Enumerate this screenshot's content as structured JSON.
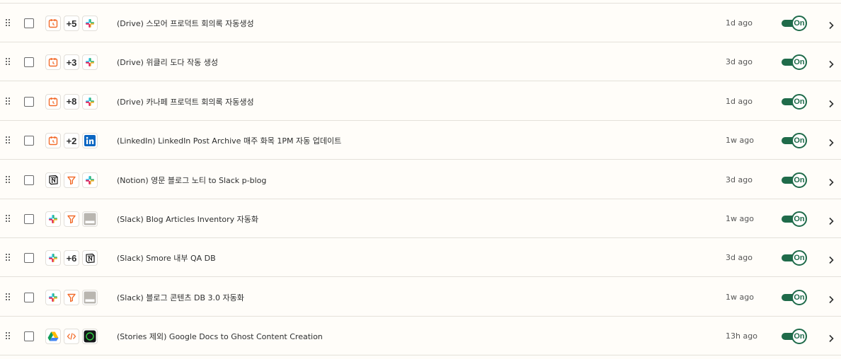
{
  "colors": {
    "toggle_on": "#1f6b4a",
    "schedule": "#f26b2a",
    "filter": "#f26b2a",
    "linkedin": "#0a66c2",
    "slack_blue": "#36c5f0",
    "slack_green": "#2eb67d",
    "slack_yellow": "#ecb22e",
    "slack_red": "#e01e5a"
  },
  "rows": [
    {
      "title": "(Drive) 스모어 프로덕트 회의록 자동생성",
      "time": "1d ago",
      "toggle": "On",
      "apps": [
        {
          "icon": "schedule-icon"
        },
        {
          "icon": "plus-count",
          "text": "+5"
        },
        {
          "icon": "slack-icon"
        }
      ]
    },
    {
      "title": "(Drive) 위클리 도다 작동 생성",
      "time": "3d ago",
      "toggle": "On",
      "apps": [
        {
          "icon": "schedule-icon"
        },
        {
          "icon": "plus-count",
          "text": "+3"
        },
        {
          "icon": "slack-icon"
        }
      ]
    },
    {
      "title": "(Drive) 카나페 프로덕트 회의록 자동생성",
      "time": "1d ago",
      "toggle": "On",
      "apps": [
        {
          "icon": "schedule-icon"
        },
        {
          "icon": "plus-count",
          "text": "+8"
        },
        {
          "icon": "slack-icon"
        }
      ]
    },
    {
      "title": "(LinkedIn) LinkedIn Post Archive 매주 화목 1PM 자동 업데이트",
      "time": "1w ago",
      "toggle": "On",
      "apps": [
        {
          "icon": "schedule-icon"
        },
        {
          "icon": "plus-count",
          "text": "+2"
        },
        {
          "icon": "linkedin-icon"
        }
      ]
    },
    {
      "title": "(Notion) 영문 블로그 노티 to Slack p-blog",
      "time": "3d ago",
      "toggle": "On",
      "apps": [
        {
          "icon": "notion-icon"
        },
        {
          "icon": "filter-icon"
        },
        {
          "icon": "slack-icon"
        }
      ]
    },
    {
      "title": "(Slack) Blog Articles Inventory 자동화",
      "time": "1w ago",
      "toggle": "On",
      "apps": [
        {
          "icon": "slack-icon"
        },
        {
          "icon": "filter-icon"
        },
        {
          "icon": "table-icon"
        }
      ]
    },
    {
      "title": "(Slack) Smore 내부 QA DB",
      "time": "3d ago",
      "toggle": "On",
      "apps": [
        {
          "icon": "slack-icon"
        },
        {
          "icon": "plus-count",
          "text": "+6"
        },
        {
          "icon": "notion-icon"
        }
      ]
    },
    {
      "title": "(Slack) 블로그 콘텐츠 DB 3.0 자동화",
      "time": "1w ago",
      "toggle": "On",
      "apps": [
        {
          "icon": "slack-icon"
        },
        {
          "icon": "filter-icon"
        },
        {
          "icon": "table-icon"
        }
      ]
    },
    {
      "title": "(Stories 제외) Google Docs to Ghost Content Creation",
      "time": "13h ago",
      "toggle": "On",
      "apps": [
        {
          "icon": "google-drive-icon"
        },
        {
          "icon": "code-icon"
        },
        {
          "icon": "ghost-icon"
        }
      ]
    }
  ]
}
